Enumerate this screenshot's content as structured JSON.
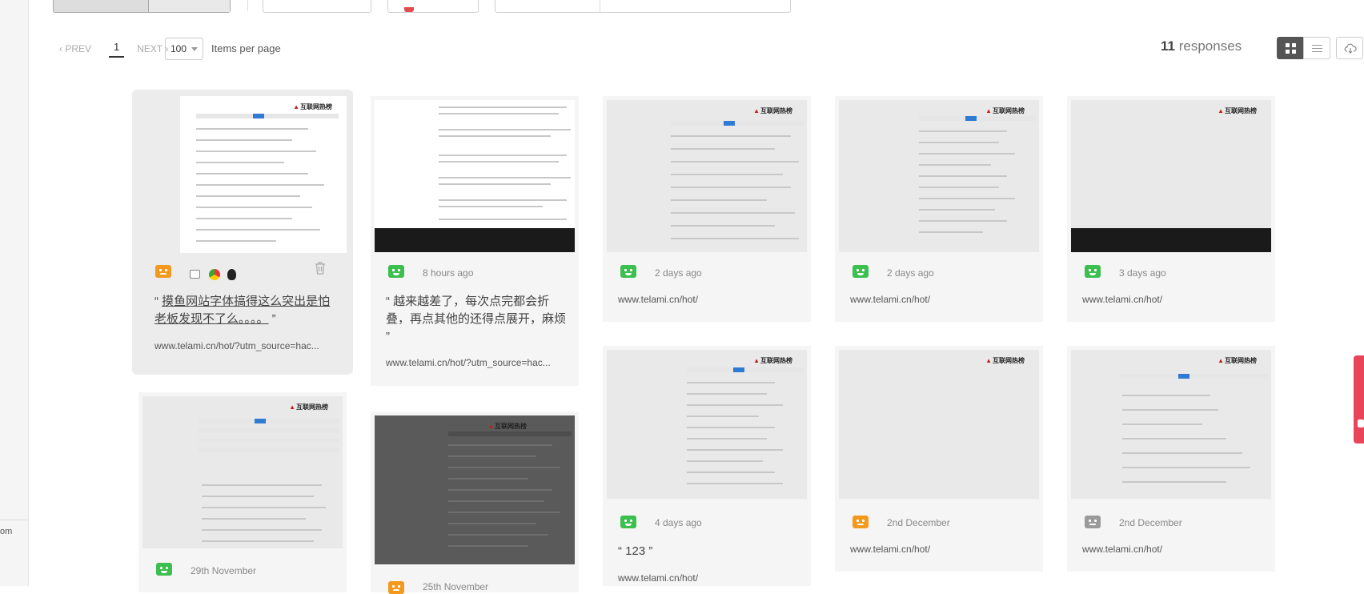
{
  "pager": {
    "prev": "‹ PREV",
    "page": "1",
    "next": "NEXT ›"
  },
  "per_page": {
    "value": "100",
    "label": "Items per page"
  },
  "responses": {
    "count": "11",
    "label": "responses"
  },
  "view": {
    "grid_icon": "grid-icon",
    "list_icon": "list-icon",
    "download_icon": "cloud-download-icon"
  },
  "left_rail_fragment": "om",
  "colors": {
    "happy": "#3bbf4f",
    "sad": "#f2991e",
    "neutral": "#9a9a9a",
    "accent_tab": "#e8445a"
  },
  "cards": [
    {
      "face": "sad",
      "time": "",
      "comment": "摸鱼网站字体搞得这么突出是怕老板发现不了么。。。。",
      "url": "www.telami.cn/hot/?utm_source=hac...",
      "selected": true
    },
    {
      "face": "happy",
      "time": "8 hours ago",
      "comment": "越来越差了，每次点完都会折叠，再点其他的还得点展开，麻烦",
      "url": "www.telami.cn/hot/?utm_source=hac..."
    },
    {
      "face": "happy",
      "time": "2 days ago",
      "comment": "",
      "url": "www.telami.cn/hot/"
    },
    {
      "face": "happy",
      "time": "2 days ago",
      "comment": "",
      "url": "www.telami.cn/hot/"
    },
    {
      "face": "happy",
      "time": "3 days ago",
      "comment": "",
      "url": "www.telami.cn/hot/"
    },
    {
      "face": "happy",
      "time": "29th November",
      "comment": "",
      "url": ""
    },
    {
      "face": "sad",
      "time": "25th November",
      "comment": "",
      "url": ""
    },
    {
      "face": "happy",
      "time": "4 days ago",
      "comment": "123",
      "url": "www.telami.cn/hot/"
    },
    {
      "face": "sad",
      "time": "2nd December",
      "comment": "",
      "url": "www.telami.cn/hot/"
    },
    {
      "face": "meh",
      "time": "2nd December",
      "comment": "",
      "url": "www.telami.cn/hot/"
    }
  ],
  "thumbnail_logo": "互联网热榜"
}
